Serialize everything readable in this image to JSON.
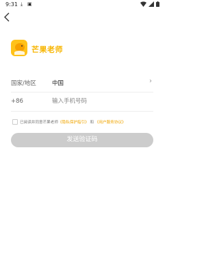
{
  "status_bar": {
    "time": "9:31",
    "left_icons": [
      "download-icon",
      "notification-a-icon"
    ],
    "right_icons": [
      "wifi-icon",
      "signal-icon",
      "battery-icon"
    ]
  },
  "brand": {
    "name": "芒果老师",
    "color": "#f7b500",
    "logo_bg": "#ffc21a"
  },
  "region": {
    "label": "国家/地区",
    "value": "中国"
  },
  "phone": {
    "prefix": "+86",
    "placeholder": "输入手机号码"
  },
  "agreement": {
    "prefix": "已阅读并同意芒果老师",
    "privacy_link": "《隐私保护指引》",
    "conjunction": "和",
    "terms_link": "《用户服务协议》"
  },
  "send_button": {
    "label": "发送验证码",
    "color": "#cccccc"
  }
}
